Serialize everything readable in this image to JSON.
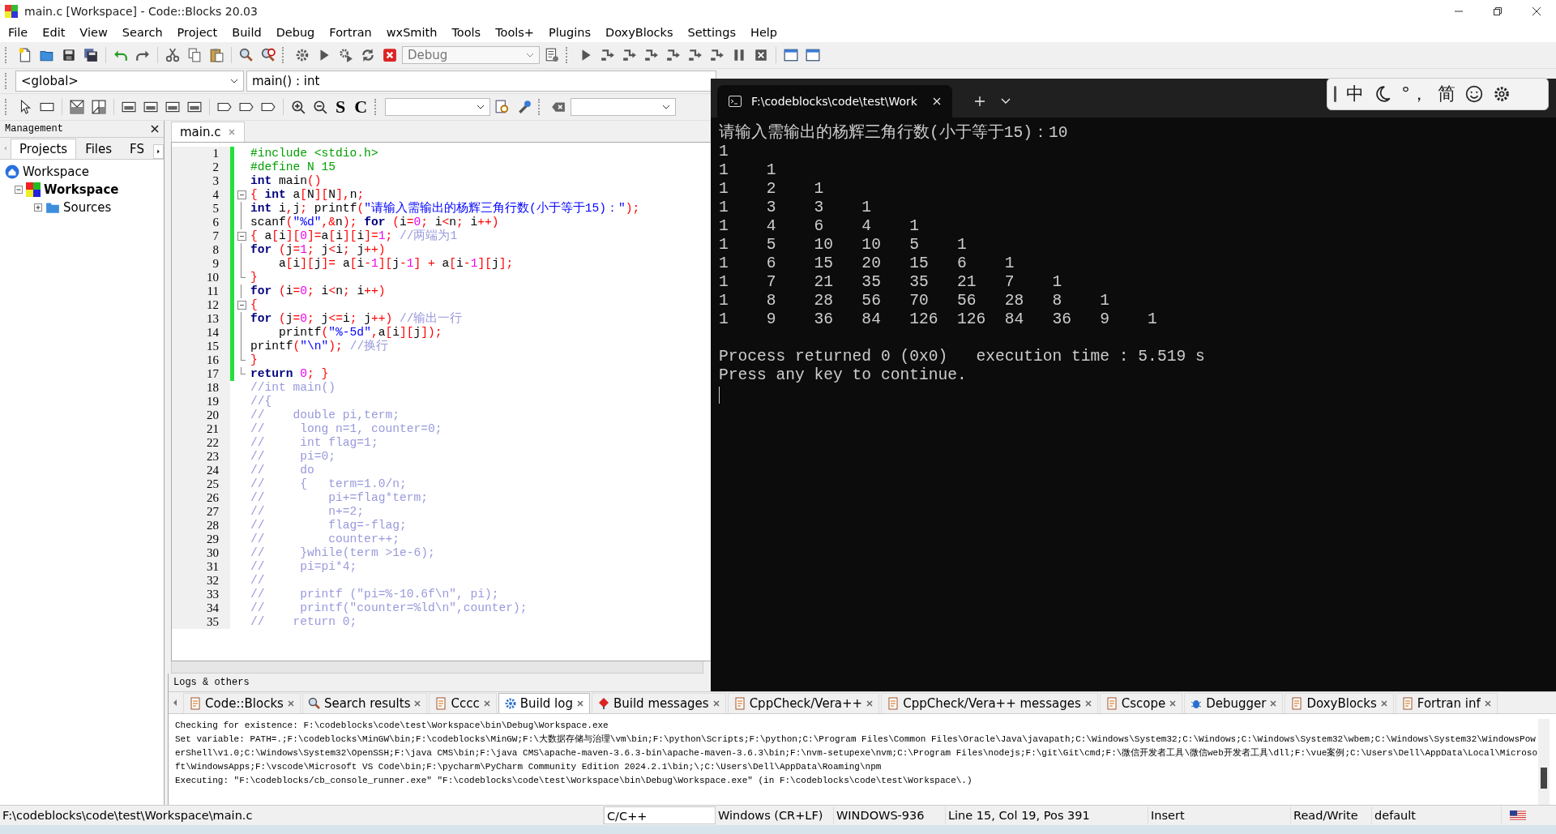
{
  "window": {
    "title": "main.c [Workspace] - Code::Blocks 20.03"
  },
  "menu": [
    "File",
    "Edit",
    "View",
    "Search",
    "Project",
    "Build",
    "Debug",
    "Fortran",
    "wxSmith",
    "Tools",
    "Tools+",
    "Plugins",
    "DoxyBlocks",
    "Settings",
    "Help"
  ],
  "build_target": "Debug",
  "code_completion": {
    "scope": "<global>",
    "function": "main() : int"
  },
  "doxy_buttons": [
    "S",
    "C"
  ],
  "management": {
    "title": "Management",
    "tabs": [
      {
        "label": "Projects",
        "selected": true
      },
      {
        "label": "Files",
        "selected": false
      },
      {
        "label": "FS",
        "selected": false
      }
    ],
    "tree": [
      {
        "label": "Workspace",
        "kind": "workspace",
        "children": [
          {
            "label": "Workspace",
            "kind": "project",
            "active": true,
            "expanded": true,
            "children": [
              {
                "label": "Sources",
                "kind": "folder",
                "active": false,
                "expanded": false
              }
            ]
          }
        ]
      }
    ]
  },
  "editor": {
    "tabs": [
      {
        "label": "main.c",
        "selected": true
      }
    ],
    "lines": [
      {
        "number": "1",
        "modified": true,
        "kind": "plain",
        "tokens": [
          {
            "text": "#include <stdio.h>",
            "kind": "pp"
          }
        ]
      },
      {
        "number": "2",
        "modified": true,
        "kind": "plain",
        "tokens": [
          {
            "text": "#define N 15",
            "kind": "pp"
          }
        ]
      },
      {
        "number": "3",
        "modified": true,
        "kind": "plain",
        "tokens": [
          {
            "text": "int",
            "kind": "kw"
          },
          {
            "text": " main",
            "kind": "id"
          },
          {
            "text": "()",
            "kind": "op"
          }
        ]
      },
      {
        "number": "4",
        "modified": true,
        "kind": "fold_start",
        "tokens": [
          {
            "text": "{ ",
            "kind": "op"
          },
          {
            "text": "int",
            "kind": "kw"
          },
          {
            "text": " a",
            "kind": "id"
          },
          {
            "text": "[",
            "kind": "op"
          },
          {
            "text": "N",
            "kind": "id"
          },
          {
            "text": "][",
            "kind": "op"
          },
          {
            "text": "N",
            "kind": "id"
          },
          {
            "text": "],",
            "kind": "op"
          },
          {
            "text": "n",
            "kind": "id"
          },
          {
            "text": ";",
            "kind": "op"
          }
        ]
      },
      {
        "number": "5",
        "modified": true,
        "kind": "fold_line",
        "tokens": [
          {
            "text": "int",
            "kind": "kw"
          },
          {
            "text": " i",
            "kind": "id"
          },
          {
            "text": ",",
            "kind": "op"
          },
          {
            "text": "j",
            "kind": "id"
          },
          {
            "text": "; ",
            "kind": "op"
          },
          {
            "text": "printf",
            "kind": "id"
          },
          {
            "text": "(",
            "kind": "op"
          },
          {
            "text": "\"请输入需输出的杨辉三角行数(小于等于15)：\"",
            "kind": "str"
          },
          {
            "text": ");",
            "kind": "op"
          }
        ]
      },
      {
        "number": "6",
        "modified": true,
        "kind": "fold_line",
        "tokens": [
          {
            "text": "scanf",
            "kind": "id"
          },
          {
            "text": "(",
            "kind": "op"
          },
          {
            "text": "\"%d\"",
            "kind": "str"
          },
          {
            "text": ",&",
            "kind": "op"
          },
          {
            "text": "n",
            "kind": "id"
          },
          {
            "text": "); ",
            "kind": "op"
          },
          {
            "text": "for",
            "kind": "kw"
          },
          {
            "text": " (",
            "kind": "op"
          },
          {
            "text": "i",
            "kind": "id"
          },
          {
            "text": "=",
            "kind": "op"
          },
          {
            "text": "0",
            "kind": "num"
          },
          {
            "text": "; ",
            "kind": "op"
          },
          {
            "text": "i",
            "kind": "id"
          },
          {
            "text": "<",
            "kind": "op"
          },
          {
            "text": "n",
            "kind": "id"
          },
          {
            "text": "; ",
            "kind": "op"
          },
          {
            "text": "i",
            "kind": "id"
          },
          {
            "text": "++)",
            "kind": "op"
          }
        ]
      },
      {
        "number": "7",
        "modified": true,
        "kind": "fold_start",
        "tokens": [
          {
            "text": "{ ",
            "kind": "op"
          },
          {
            "text": "a",
            "kind": "id"
          },
          {
            "text": "[",
            "kind": "op"
          },
          {
            "text": "i",
            "kind": "id"
          },
          {
            "text": "][",
            "kind": "op"
          },
          {
            "text": "0",
            "kind": "num"
          },
          {
            "text": "]=",
            "kind": "op"
          },
          {
            "text": "a",
            "kind": "id"
          },
          {
            "text": "[",
            "kind": "op"
          },
          {
            "text": "i",
            "kind": "id"
          },
          {
            "text": "][",
            "kind": "op"
          },
          {
            "text": "i",
            "kind": "id"
          },
          {
            "text": "]=",
            "kind": "op"
          },
          {
            "text": "1",
            "kind": "num"
          },
          {
            "text": "; ",
            "kind": "op"
          },
          {
            "text": "//两端为1",
            "kind": "cm"
          }
        ]
      },
      {
        "number": "8",
        "modified": true,
        "kind": "fold_line",
        "tokens": [
          {
            "text": "for",
            "kind": "kw"
          },
          {
            "text": " (",
            "kind": "op"
          },
          {
            "text": "j",
            "kind": "id"
          },
          {
            "text": "=",
            "kind": "op"
          },
          {
            "text": "1",
            "kind": "num"
          },
          {
            "text": "; ",
            "kind": "op"
          },
          {
            "text": "j",
            "kind": "id"
          },
          {
            "text": "<",
            "kind": "op"
          },
          {
            "text": "i",
            "kind": "id"
          },
          {
            "text": "; ",
            "kind": "op"
          },
          {
            "text": "j",
            "kind": "id"
          },
          {
            "text": "++)",
            "kind": "op"
          }
        ]
      },
      {
        "number": "9",
        "modified": true,
        "kind": "fold_line",
        "tokens": [
          {
            "text": "    a",
            "kind": "id"
          },
          {
            "text": "[",
            "kind": "op"
          },
          {
            "text": "i",
            "kind": "id"
          },
          {
            "text": "][",
            "kind": "op"
          },
          {
            "text": "j",
            "kind": "id"
          },
          {
            "text": "]= ",
            "kind": "op"
          },
          {
            "text": "a",
            "kind": "id"
          },
          {
            "text": "[",
            "kind": "op"
          },
          {
            "text": "i",
            "kind": "id"
          },
          {
            "text": "-",
            "kind": "op"
          },
          {
            "text": "1",
            "kind": "num"
          },
          {
            "text": "][",
            "kind": "op"
          },
          {
            "text": "j",
            "kind": "id"
          },
          {
            "text": "-",
            "kind": "op"
          },
          {
            "text": "1",
            "kind": "num"
          },
          {
            "text": "] + ",
            "kind": "op"
          },
          {
            "text": "a",
            "kind": "id"
          },
          {
            "text": "[",
            "kind": "op"
          },
          {
            "text": "i",
            "kind": "id"
          },
          {
            "text": "-",
            "kind": "op"
          },
          {
            "text": "1",
            "kind": "num"
          },
          {
            "text": "][",
            "kind": "op"
          },
          {
            "text": "j",
            "kind": "id"
          },
          {
            "text": "];",
            "kind": "op"
          }
        ]
      },
      {
        "number": "10",
        "modified": true,
        "kind": "fold_end",
        "tokens": [
          {
            "text": "}",
            "kind": "op"
          }
        ]
      },
      {
        "number": "11",
        "modified": true,
        "kind": "fold_line",
        "tokens": [
          {
            "text": "for",
            "kind": "kw"
          },
          {
            "text": " (",
            "kind": "op"
          },
          {
            "text": "i",
            "kind": "id"
          },
          {
            "text": "=",
            "kind": "op"
          },
          {
            "text": "0",
            "kind": "num"
          },
          {
            "text": "; ",
            "kind": "op"
          },
          {
            "text": "i",
            "kind": "id"
          },
          {
            "text": "<",
            "kind": "op"
          },
          {
            "text": "n",
            "kind": "id"
          },
          {
            "text": "; ",
            "kind": "op"
          },
          {
            "text": "i",
            "kind": "id"
          },
          {
            "text": "++)",
            "kind": "op"
          }
        ]
      },
      {
        "number": "12",
        "modified": true,
        "kind": "fold_start",
        "tokens": [
          {
            "text": "{",
            "kind": "op"
          }
        ]
      },
      {
        "number": "13",
        "modified": true,
        "kind": "fold_line",
        "tokens": [
          {
            "text": "for",
            "kind": "kw"
          },
          {
            "text": " (",
            "kind": "op"
          },
          {
            "text": "j",
            "kind": "id"
          },
          {
            "text": "=",
            "kind": "op"
          },
          {
            "text": "0",
            "kind": "num"
          },
          {
            "text": "; ",
            "kind": "op"
          },
          {
            "text": "j",
            "kind": "id"
          },
          {
            "text": "<=",
            "kind": "op"
          },
          {
            "text": "i",
            "kind": "id"
          },
          {
            "text": "; ",
            "kind": "op"
          },
          {
            "text": "j",
            "kind": "id"
          },
          {
            "text": "++) ",
            "kind": "op"
          },
          {
            "text": "//输出一行",
            "kind": "cm"
          }
        ]
      },
      {
        "number": "14",
        "modified": true,
        "kind": "fold_line",
        "tokens": [
          {
            "text": "    printf",
            "kind": "id"
          },
          {
            "text": "(",
            "kind": "op"
          },
          {
            "text": "\"%-5d\"",
            "kind": "str"
          },
          {
            "text": ",",
            "kind": "op"
          },
          {
            "text": "a",
            "kind": "id"
          },
          {
            "text": "[",
            "kind": "op"
          },
          {
            "text": "i",
            "kind": "id"
          },
          {
            "text": "][",
            "kind": "op"
          },
          {
            "text": "j",
            "kind": "id"
          },
          {
            "text": "]);",
            "kind": "op"
          }
        ]
      },
      {
        "number": "15",
        "modified": true,
        "kind": "fold_line",
        "tokens": [
          {
            "text": "printf",
            "kind": "id"
          },
          {
            "text": "(",
            "kind": "op"
          },
          {
            "text": "\"\\n\"",
            "kind": "str"
          },
          {
            "text": "); ",
            "kind": "op"
          },
          {
            "text": "//换行",
            "kind": "cm"
          }
        ]
      },
      {
        "number": "16",
        "modified": true,
        "kind": "fold_end",
        "tokens": [
          {
            "text": "}",
            "kind": "op"
          }
        ]
      },
      {
        "number": "17",
        "modified": true,
        "kind": "fold_last",
        "tokens": [
          {
            "text": "return",
            "kind": "kw"
          },
          {
            "text": " 0",
            "kind": "num"
          },
          {
            "text": "; }",
            "kind": "op"
          }
        ]
      },
      {
        "number": "18",
        "modified": false,
        "kind": "plain",
        "tokens": [
          {
            "text": "//int main()",
            "kind": "cm"
          }
        ]
      },
      {
        "number": "19",
        "modified": false,
        "kind": "plain",
        "tokens": [
          {
            "text": "//{",
            "kind": "cm"
          }
        ]
      },
      {
        "number": "20",
        "modified": false,
        "kind": "plain",
        "tokens": [
          {
            "text": "//    double pi,term;",
            "kind": "cm"
          }
        ]
      },
      {
        "number": "21",
        "modified": false,
        "kind": "plain",
        "tokens": [
          {
            "text": "//     long n=1, counter=0;",
            "kind": "cm"
          }
        ]
      },
      {
        "number": "22",
        "modified": false,
        "kind": "plain",
        "tokens": [
          {
            "text": "//     int flag=1;",
            "kind": "cm"
          }
        ]
      },
      {
        "number": "23",
        "modified": false,
        "kind": "plain",
        "tokens": [
          {
            "text": "//     pi=0;",
            "kind": "cm"
          }
        ]
      },
      {
        "number": "24",
        "modified": false,
        "kind": "plain",
        "tokens": [
          {
            "text": "//     do",
            "kind": "cm"
          }
        ]
      },
      {
        "number": "25",
        "modified": false,
        "kind": "plain",
        "tokens": [
          {
            "text": "//     {   term=1.0/n;",
            "kind": "cm"
          }
        ]
      },
      {
        "number": "26",
        "modified": false,
        "kind": "plain",
        "tokens": [
          {
            "text": "//         pi+=flag*term;",
            "kind": "cm"
          }
        ]
      },
      {
        "number": "27",
        "modified": false,
        "kind": "plain",
        "tokens": [
          {
            "text": "//         n+=2;",
            "kind": "cm"
          }
        ]
      },
      {
        "number": "28",
        "modified": false,
        "kind": "plain",
        "tokens": [
          {
            "text": "//         flag=-flag;",
            "kind": "cm"
          }
        ]
      },
      {
        "number": "29",
        "modified": false,
        "kind": "plain",
        "tokens": [
          {
            "text": "//         counter++;",
            "kind": "cm"
          }
        ]
      },
      {
        "number": "30",
        "modified": false,
        "kind": "plain",
        "tokens": [
          {
            "text": "//     }while(term >1e-6);",
            "kind": "cm"
          }
        ]
      },
      {
        "number": "31",
        "modified": false,
        "kind": "plain",
        "tokens": [
          {
            "text": "//     pi=pi*4;",
            "kind": "cm"
          }
        ]
      },
      {
        "number": "32",
        "modified": false,
        "kind": "plain",
        "tokens": [
          {
            "text": "//",
            "kind": "cm"
          }
        ]
      },
      {
        "number": "33",
        "modified": false,
        "kind": "plain",
        "tokens": [
          {
            "text": "//     printf (\"pi=%-10.6f\\n\", pi);",
            "kind": "cm"
          }
        ]
      },
      {
        "number": "34",
        "modified": false,
        "kind": "plain",
        "tokens": [
          {
            "text": "//     printf(\"counter=%ld\\n\",counter);",
            "kind": "cm"
          }
        ]
      },
      {
        "number": "35",
        "modified": false,
        "kind": "plain",
        "tokens": [
          {
            "text": "//    return 0;",
            "kind": "cm"
          }
        ]
      }
    ]
  },
  "logs": {
    "title": "Logs & others",
    "tabs": [
      {
        "label": "Code::Blocks",
        "selected": false
      },
      {
        "label": "Search results",
        "selected": false
      },
      {
        "label": "Cccc",
        "selected": false
      },
      {
        "label": "Build log",
        "selected": true
      },
      {
        "label": "Build messages",
        "selected": false
      },
      {
        "label": "CppCheck/Vera++",
        "selected": false
      },
      {
        "label": "CppCheck/Vera++ messages",
        "selected": false
      },
      {
        "label": "Cscope",
        "selected": false
      },
      {
        "label": "Debugger",
        "selected": false
      },
      {
        "label": "DoxyBlocks",
        "selected": false
      },
      {
        "label": "Fortran inf",
        "selected": false
      }
    ],
    "lines": [
      "Checking for existence: F:\\codeblocks\\code\\test\\Workspace\\bin\\Debug\\Workspace.exe",
      "Set variable: PATH=.;F:\\codeblocks\\MinGW\\bin;F:\\codeblocks\\MinGW;F:\\大数据存储与治理\\vm\\bin;F:\\python\\Scripts;F:\\python;C:\\Program Files\\Common Files\\Oracle\\Java\\javapath;C:\\Windows\\System32;C:\\Windows;C:\\Windows\\System32\\wbem;C:\\Windows\\System32\\WindowsPowerShell\\v1.0;C:\\Windows\\System32\\OpenSSH;F:\\java CMS\\bin;F:\\java CMS\\apache-maven-3.6.3-bin\\apache-maven-3.6.3\\bin;F:\\nvm-setupexe\\nvm;C:\\Program Files\\nodejs;F:\\git\\Git\\cmd;F:\\微信开发者工具\\微信web开发者工具\\dll;F:\\vue案例;C:\\Users\\Dell\\AppData\\Local\\Microsoft\\WindowsApps;F:\\vscode\\Microsoft VS Code\\bin;F:\\pycharm\\PyCharm Community Edition 2024.2.1\\bin;\\;C:\\Users\\Dell\\AppData\\Roaming\\npm",
      "Executing: \"F:\\codeblocks/cb_console_runner.exe\" \"F:\\codeblocks\\code\\test\\Workspace\\bin\\Debug\\Workspace.exe\"  (in F:\\codeblocks\\code\\test\\Workspace\\.)"
    ]
  },
  "status_bar": [
    "F:\\codeblocks\\code\\test\\Workspace\\main.c",
    "C/C++",
    "Windows (CR+LF)",
    "WINDOWS-936",
    "Line 15, Col 19, Pos 391",
    "Insert",
    "Read/Write",
    "default"
  ],
  "console": {
    "tab": "F:\\codeblocks\\code\\test\\Work",
    "output": [
      "请输入需输出的杨辉三角行数(小于等于15)：10",
      "1",
      "1    1",
      "1    2    1",
      "1    3    3    1",
      "1    4    6    4    1",
      "1    5    10   10   5    1",
      "1    6    15   20   15   6    1",
      "1    7    21   35   35   21   7    1",
      "1    8    28   56   70   56   28   8    1",
      "1    9    36   84   126  126  84   36   9    1"
    ],
    "footer": [
      "Process returned 0 (0x0)   execution time : 5.519 s",
      "Press any key to continue."
    ]
  },
  "ime": {
    "mode": "中",
    "punctuation": "°，",
    "script": "简"
  }
}
